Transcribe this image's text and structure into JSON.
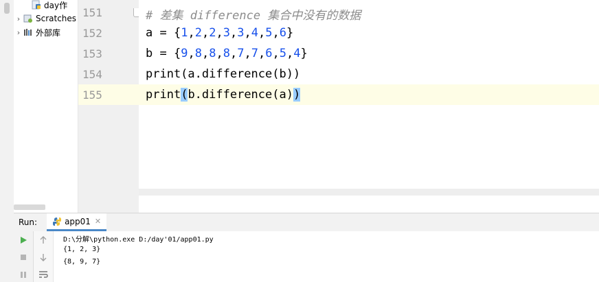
{
  "project_tree": {
    "items": [
      {
        "label": "day作",
        "icon": "python-file-icon"
      },
      {
        "label": "Scratches",
        "icon": "scratches-icon"
      },
      {
        "label": "外部库",
        "icon": "library-icon"
      }
    ]
  },
  "editor": {
    "lines": [
      {
        "number": "151",
        "parts": [
          {
            "t": "# 差集 difference 集合中没有的数据",
            "c": "comment"
          }
        ]
      },
      {
        "number": "152",
        "parts": [
          {
            "t": "a = {",
            "c": ""
          },
          {
            "t": "1",
            "c": "num"
          },
          {
            "t": ",",
            "c": ""
          },
          {
            "t": "2",
            "c": "num"
          },
          {
            "t": ",",
            "c": ""
          },
          {
            "t": "2",
            "c": "num"
          },
          {
            "t": ",",
            "c": ""
          },
          {
            "t": "3",
            "c": "num"
          },
          {
            "t": ",",
            "c": ""
          },
          {
            "t": "3",
            "c": "num"
          },
          {
            "t": ",",
            "c": ""
          },
          {
            "t": "4",
            "c": "num"
          },
          {
            "t": ",",
            "c": ""
          },
          {
            "t": "5",
            "c": "num"
          },
          {
            "t": ",",
            "c": ""
          },
          {
            "t": "6",
            "c": "num"
          },
          {
            "t": "}",
            "c": ""
          }
        ]
      },
      {
        "number": "153",
        "parts": [
          {
            "t": "b = {",
            "c": ""
          },
          {
            "t": "9",
            "c": "num"
          },
          {
            "t": ",",
            "c": ""
          },
          {
            "t": "8",
            "c": "num"
          },
          {
            "t": ",",
            "c": ""
          },
          {
            "t": "8",
            "c": "num"
          },
          {
            "t": ",",
            "c": ""
          },
          {
            "t": "8",
            "c": "num"
          },
          {
            "t": ",",
            "c": ""
          },
          {
            "t": "7",
            "c": "num"
          },
          {
            "t": ",",
            "c": ""
          },
          {
            "t": "7",
            "c": "num"
          },
          {
            "t": ",",
            "c": ""
          },
          {
            "t": "6",
            "c": "num"
          },
          {
            "t": ",",
            "c": ""
          },
          {
            "t": "5",
            "c": "num"
          },
          {
            "t": ",",
            "c": ""
          },
          {
            "t": "4",
            "c": "num"
          },
          {
            "t": "}",
            "c": ""
          }
        ]
      },
      {
        "number": "154",
        "parts": [
          {
            "t": "print(a.difference(b))",
            "c": ""
          }
        ]
      },
      {
        "number": "155",
        "current": true,
        "parts": [
          {
            "t": "print",
            "c": ""
          },
          {
            "t": "(",
            "c": "brace-hl"
          },
          {
            "t": "b.difference(a)",
            "c": ""
          },
          {
            "t": ")",
            "c": "brace-hl"
          }
        ]
      }
    ]
  },
  "run_window": {
    "label": "Run:",
    "tab_label": "app01",
    "console_lines": [
      "D:\\分解\\python.exe D:/day'01/app01.py",
      "{1, 2, 3}",
      "{8, 9, 7}"
    ]
  },
  "colors": {
    "keyword_number": "#1750eb",
    "comment": "#8c8c8c",
    "current_line": "#fefde6",
    "brace_highlight": "#99ccff",
    "run_green": "#4caf50"
  }
}
